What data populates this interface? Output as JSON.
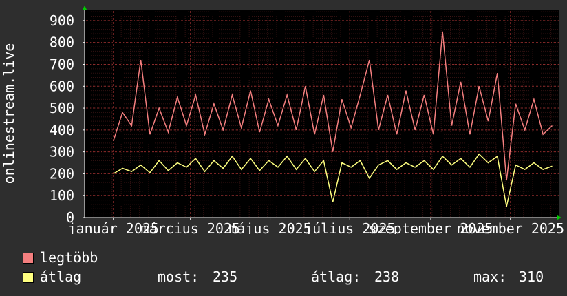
{
  "chart_data": {
    "type": "line",
    "ylabel": "onlinestream.live",
    "ylim": [
      0,
      950
    ],
    "yticks": [
      0,
      100,
      200,
      300,
      400,
      500,
      600,
      700,
      800,
      900
    ],
    "xlim": [
      "2024-12-10",
      "2025-12-08"
    ],
    "xticks": [
      {
        "date": "2025-01-01",
        "label": "január 2025"
      },
      {
        "date": "2025-03-01",
        "label": "március 2025"
      },
      {
        "date": "2025-05-01",
        "label": "május 2025"
      },
      {
        "date": "2025-07-01",
        "label": "július 2025"
      },
      {
        "date": "2025-09-01",
        "label": "szeptember 2025"
      },
      {
        "date": "2025-11-01",
        "label": "november 2025"
      }
    ],
    "grid": true,
    "colors": {
      "background": "#2e2e2e",
      "plot": "#000000",
      "grid": "#5a2020",
      "axis": "#ffffff",
      "arrow": "#00cc00"
    },
    "series": [
      {
        "name": "legtöbb",
        "color": "#f47f7f",
        "x": [
          "2025-01-01",
          "2025-01-08",
          "2025-01-15",
          "2025-01-22",
          "2025-01-29",
          "2025-02-05",
          "2025-02-12",
          "2025-02-19",
          "2025-02-26",
          "2025-03-05",
          "2025-03-12",
          "2025-03-19",
          "2025-03-26",
          "2025-04-02",
          "2025-04-09",
          "2025-04-16",
          "2025-04-23",
          "2025-04-30",
          "2025-05-07",
          "2025-05-14",
          "2025-05-21",
          "2025-05-28",
          "2025-06-04",
          "2025-06-11",
          "2025-06-18",
          "2025-06-25",
          "2025-07-02",
          "2025-07-09",
          "2025-07-16",
          "2025-07-23",
          "2025-07-30",
          "2025-08-06",
          "2025-08-13",
          "2025-08-20",
          "2025-08-27",
          "2025-09-03",
          "2025-09-10",
          "2025-09-17",
          "2025-09-24",
          "2025-10-01",
          "2025-10-08",
          "2025-10-15",
          "2025-10-22",
          "2025-10-29",
          "2025-11-05",
          "2025-11-12",
          "2025-11-19",
          "2025-11-26",
          "2025-12-03"
        ],
        "values": [
          350,
          480,
          420,
          720,
          380,
          500,
          390,
          550,
          420,
          560,
          380,
          520,
          400,
          560,
          410,
          580,
          390,
          540,
          420,
          560,
          400,
          600,
          380,
          560,
          300,
          540,
          410,
          560,
          720,
          400,
          560,
          380,
          580,
          400,
          560,
          380,
          850,
          420,
          620,
          380,
          600,
          440,
          660,
          170,
          520,
          400,
          540,
          380,
          420
        ]
      },
      {
        "name": "átlag",
        "color": "#ffff80",
        "x": [
          "2025-01-01",
          "2025-01-08",
          "2025-01-15",
          "2025-01-22",
          "2025-01-29",
          "2025-02-05",
          "2025-02-12",
          "2025-02-19",
          "2025-02-26",
          "2025-03-05",
          "2025-03-12",
          "2025-03-19",
          "2025-03-26",
          "2025-04-02",
          "2025-04-09",
          "2025-04-16",
          "2025-04-23",
          "2025-04-30",
          "2025-05-07",
          "2025-05-14",
          "2025-05-21",
          "2025-05-28",
          "2025-06-04",
          "2025-06-11",
          "2025-06-18",
          "2025-06-25",
          "2025-07-02",
          "2025-07-09",
          "2025-07-16",
          "2025-07-23",
          "2025-07-30",
          "2025-08-06",
          "2025-08-13",
          "2025-08-20",
          "2025-08-27",
          "2025-09-03",
          "2025-09-10",
          "2025-09-17",
          "2025-09-24",
          "2025-10-01",
          "2025-10-08",
          "2025-10-15",
          "2025-10-22",
          "2025-10-29",
          "2025-11-05",
          "2025-11-12",
          "2025-11-19",
          "2025-11-26",
          "2025-12-03"
        ],
        "values": [
          200,
          225,
          210,
          240,
          205,
          260,
          215,
          250,
          230,
          270,
          210,
          260,
          225,
          280,
          220,
          270,
          215,
          260,
          230,
          280,
          220,
          270,
          210,
          260,
          70,
          250,
          230,
          260,
          180,
          240,
          260,
          220,
          250,
          230,
          260,
          220,
          280,
          240,
          270,
          230,
          290,
          250,
          280,
          50,
          240,
          220,
          250,
          220,
          235
        ]
      }
    ]
  },
  "legend": {
    "series1_label": "legtöbb",
    "series2_label": "átlag",
    "most_label": "most:",
    "most_value": "235",
    "avg_label": "átlag:",
    "avg_value": "238",
    "max_label": "max:",
    "max_value": "310"
  }
}
